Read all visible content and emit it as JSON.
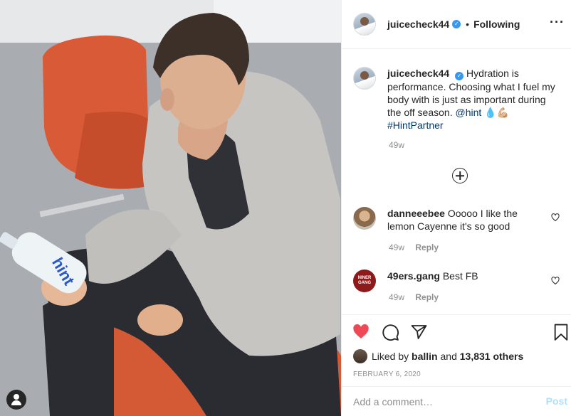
{
  "post": {
    "username": "juicecheck44",
    "verified_badge": "✓",
    "separator": "•",
    "follow_status": "Following",
    "more_glyph": "···",
    "caption_text": "Hydration is performance. Choosing what I fuel my body with is just as important during the off season.",
    "mention": "@hint",
    "caption_emoji": "💧💪🏼",
    "hashtag": "#HintPartner",
    "caption_time": "49w",
    "bottle_brand": "hint"
  },
  "comments": [
    {
      "username": "danneeebee",
      "text": "Ooooo I like the lemon Cayenne it's so good",
      "time": "49w",
      "reply_label": "Reply"
    },
    {
      "username": "49ers.gang",
      "avatar_text": "NINER GANG",
      "text": "Best FB",
      "time": "49w",
      "reply_label": "Reply"
    }
  ],
  "likes": {
    "prefix": "Liked by",
    "user": "ballin",
    "joiner": "and",
    "others": "13,831 others"
  },
  "date": "FEBRUARY 6, 2020",
  "comment_box": {
    "placeholder": "Add a comment…",
    "post_label": "Post"
  },
  "colors": {
    "like_red": "#ed4956",
    "link_blue": "#00376b",
    "verified_blue": "#3897f0",
    "post_disabled": "#b2dffc"
  },
  "icons": [
    "heart-filled-icon",
    "comment-icon",
    "share-icon",
    "bookmark-icon",
    "add-comments-icon",
    "heart-outline-icon",
    "user-tag-icon",
    "more-options-icon",
    "verified-icon"
  ]
}
